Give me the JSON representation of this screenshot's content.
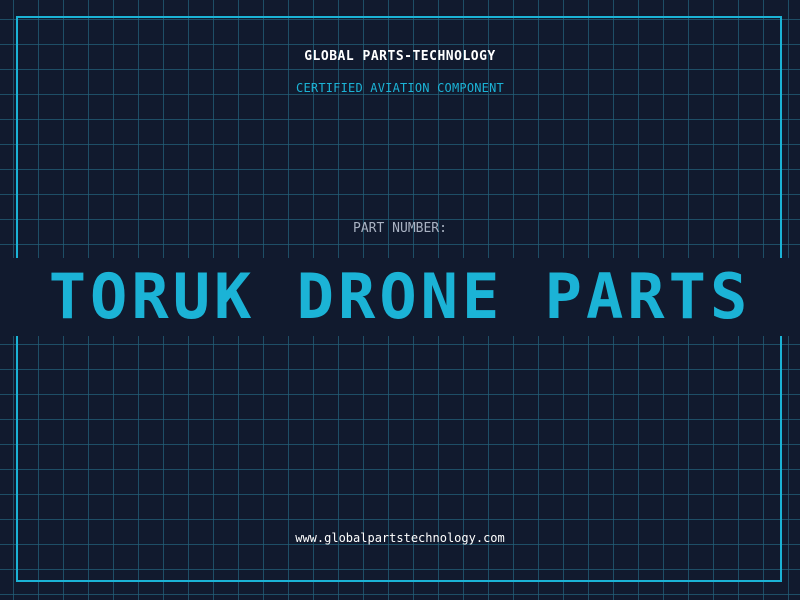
{
  "header": {
    "company": "GLOBAL PARTS-TECHNOLOGY",
    "subtitle": "CERTIFIED AVIATION COMPONENT"
  },
  "part": {
    "label": "PART NUMBER:",
    "value": "TORUK DRONE PARTS"
  },
  "footer": {
    "website": "www.globalpartstechnology.com"
  },
  "colors": {
    "background": "#111a2e",
    "grid": "#235f78",
    "accent": "#1bb3d6",
    "text_primary": "#ffffff",
    "text_muted": "#a9b2c2"
  }
}
